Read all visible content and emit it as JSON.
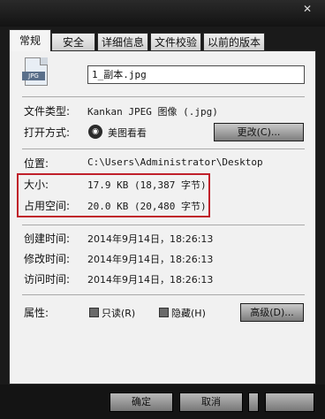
{
  "tabs": [
    "常规",
    "安全",
    "详细信息",
    "文件校验",
    "以前的版本"
  ],
  "file": {
    "icon_badge": "JPG",
    "name": "1_副本.jpg"
  },
  "props": {
    "type_label": "文件类型:",
    "type_value": "Kankan JPEG 图像 (.jpg)",
    "open_label": "打开方式:",
    "open_icon": "meitu-app-icon",
    "open_value": "美图看看",
    "change_button": "更改(C)...",
    "location_label": "位置:",
    "location_value": "C:\\Users\\Administrator\\Desktop",
    "size_label": "大小:",
    "size_value": "17.9 KB (18,387 字节)",
    "disk_label": "占用空间:",
    "disk_value": "20.0 KB (20,480 字节)",
    "created_label": "创建时间:",
    "created_value": "2014年9月14日，18:26:13",
    "modified_label": "修改时间:",
    "modified_value": "2014年9月14日，18:26:13",
    "accessed_label": "访问时间:",
    "accessed_value": "2014年9月14日，18:26:13",
    "attr_label": "属性:",
    "readonly_label": "只读(R)",
    "hidden_label": "隐藏(H)",
    "advanced_button": "高级(D)..."
  },
  "footer": {
    "ok": "确定",
    "cancel": "取消"
  },
  "colors": {
    "highlight_border": "#c0202a",
    "panel_bg": "#f1f1f1"
  }
}
